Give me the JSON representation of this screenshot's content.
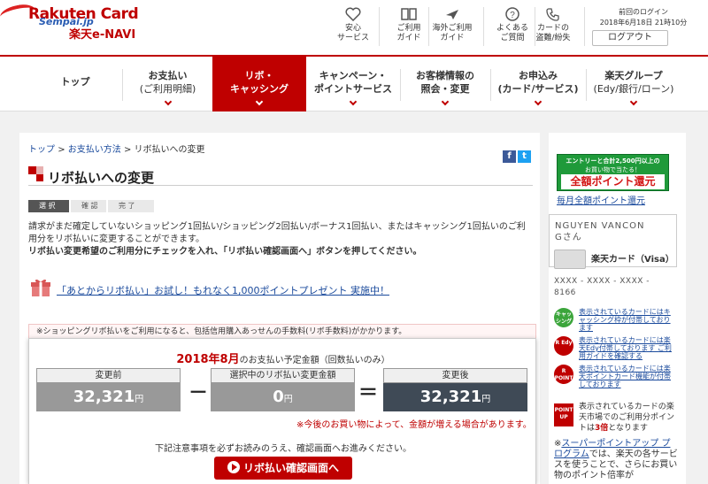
{
  "header": {
    "logo_en": "Rakuten Card",
    "logo_jp": "楽天e-NAVI",
    "watermark": "Sempai.jp",
    "icons": [
      {
        "label": "安心\nサービス",
        "icon": "heart-icon"
      },
      {
        "label": "ご利用\nガイド",
        "icon": "book-icon"
      },
      {
        "label": "海外ご利用\nガイド",
        "icon": "airplane-icon"
      },
      {
        "label": "よくある\nご質問",
        "icon": "question-icon"
      },
      {
        "label": "カードの\n盗難/紛失",
        "icon": "phone-icon"
      }
    ],
    "login_label": "前回のログイン",
    "login_time": "2018年6月18日 21時10分",
    "logout": "ログアウト"
  },
  "nav": {
    "items": [
      {
        "l1": "トップ",
        "l2": ""
      },
      {
        "l1": "お支払い",
        "l2": "(ご利用明細)"
      },
      {
        "l1": "リボ・",
        "l2": "キャッシング"
      },
      {
        "l1": "キャンペーン・",
        "l2": "ポイントサービス"
      },
      {
        "l1": "お客様情報の",
        "l2": "照会・変更"
      },
      {
        "l1": "お申込み",
        "l2": "(カード/サービス)"
      },
      {
        "l1": "楽天グループ",
        "l2": "(Edy/銀行/ローン)"
      }
    ]
  },
  "breadcrumb": {
    "top": "トップ",
    "sep": ">",
    "payment_method": "お支払い方法",
    "current": "リボ払いへの変更"
  },
  "share": {
    "facebook": "f",
    "twitter": "t"
  },
  "page": {
    "title": "リボ払いへの変更",
    "steps": [
      "選 択",
      "確 認",
      "完 了"
    ],
    "desc_1": "請求がまだ確定していないショッピング1回払い/ショッピング2回払い/ボーナス1回払い、またはキャッシング1回払いのご利用分をリボ払いに変更することができます。",
    "desc_2": "リボ払い変更希望のご利用分にチェックを入れ、「リボ払い確認画面へ」ボタンを押してください。",
    "promo": "「あとからリボ払い」お試し！もれなく1,000ポイントプレゼント 実施中！",
    "note": "※ショッピングリボ払いをご利用になると、包括信用購入あっせんの手数料(リボ手数料)がかかります。"
  },
  "calc": {
    "year_month": "2018年8月",
    "heading_suffix": "のお支払い予定金額（回数払いのみ）",
    "before_label": "変更前",
    "before_value": "32,321",
    "selected_label": "選択中のリボ払い変更金額",
    "selected_value": "0",
    "after_label": "変更後",
    "after_value": "32,321",
    "yen": "円",
    "minus": "－",
    "equals": "＝",
    "warning": "※今後のお買い物によって、金額が増える場合があります。",
    "notice": "下記注意事項を必ずお読みのうえ、確認画面へお進みください。",
    "confirm_button": "リボ払い確認画面へ"
  },
  "sidebar": {
    "ad_line1": "エントリーと合計2,500円以上の",
    "ad_line2": "お買い物で当たる！",
    "ad_line3": "全額ポイント還元",
    "ad_link": "毎月全額ポイント還元",
    "user_name": "NGUYEN VANCON",
    "user_suffix": "Gさん",
    "card_name": "楽天カード（Visa）",
    "card_number": "XXXX - XXXX - XXXX - 8166",
    "services": [
      {
        "badge": "キャッシング",
        "text": "表示されているカードにはキャッシング枠が付帯しております"
      },
      {
        "badge": "R Edy",
        "text": "表示されているカードには楽天Edy付帯しております ご利用ガイドを確認する"
      },
      {
        "badge": "R POINT",
        "text": "表示されているカードには楽天ポイントカード機能が付帯しております"
      }
    ],
    "sp_badge": "POINT UP",
    "sp_text_1": "表示されているカードの楽天市場でのご利用分ポイントは",
    "sp_text_bold": "3倍",
    "sp_text_2": "となります",
    "spu_prefix": "※",
    "spu_link": "スーパーポイントアップ プログラム",
    "spu_text": "では、楽天の各サービスを使うことで、さらにお買い物のポイント倍率が"
  },
  "colors": {
    "brand_red": "#bf0000",
    "box_gray": "#999999",
    "box_dark": "#3f4a56",
    "link_blue": "#1a4a9c"
  }
}
